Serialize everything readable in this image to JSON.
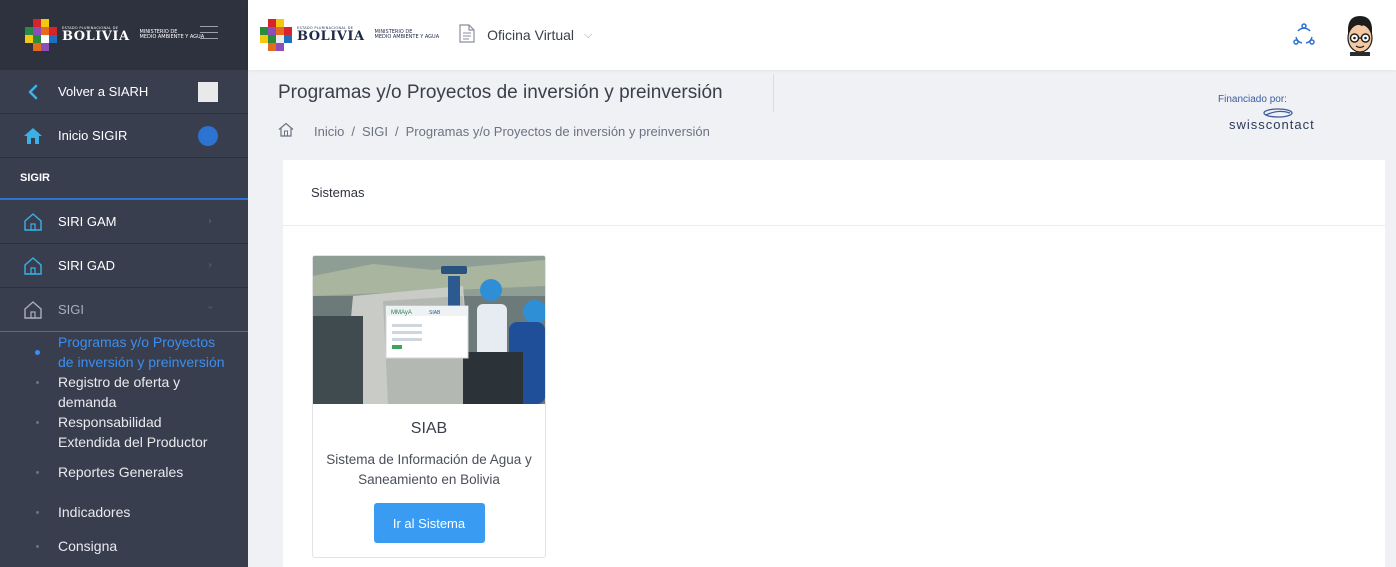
{
  "sidebar": {
    "brand": {
      "small": "ESTADO PLURINACIONAL DE",
      "big": "BOLIVIA",
      "ministry": "MINISTERIO DE\nMEDIO AMBIENTE Y AGUA"
    },
    "back_label": "Volver a SIARH",
    "home_label": "Inicio SIGIR",
    "section_label": "SIGIR",
    "items": [
      {
        "label": "SIRI GAM"
      },
      {
        "label": "SIRI GAD"
      },
      {
        "label": "SIGI"
      }
    ],
    "submenu": [
      {
        "label": "Programas y/o Proyectos de inversión y preinversión",
        "active": true
      },
      {
        "label": "Registro de oferta y demanda"
      },
      {
        "label": "Responsabilidad Extendida del Productor"
      },
      {
        "label": "Reportes Generales"
      },
      {
        "label": "Indicadores"
      },
      {
        "label": "Consigna"
      }
    ]
  },
  "topbar": {
    "brand": {
      "small": "ESTADO PLURINACIONAL DE",
      "big": "BOLIVIA",
      "ministry": "MINISTERIO DE\nMEDIO AMBIENTE Y AGUA"
    },
    "menu_label": "Oficina Virtual"
  },
  "header": {
    "title": "Programas y/o Proyectos de inversión y preinversión",
    "breadcrumb": [
      "Inicio",
      "SIGI",
      "Programas y/o Proyectos de inversión y preinversión"
    ],
    "financed_label": "Financiado por:",
    "financed_brand_a": "swiss",
    "financed_brand_b": "contact"
  },
  "panel": {
    "heading": "Sistemas",
    "card": {
      "title": "SIAB",
      "description": "Sistema de Información de Agua y Saneamiento en Bolivia",
      "button_label": "Ir al Sistema",
      "image_logo": "MMAyA",
      "image_text": "SIAB"
    }
  },
  "colors": {
    "sidebar_bg": "#393e4f",
    "accent": "#2c73d2",
    "active_link": "#3a8ff0",
    "button": "#3a9bf2"
  },
  "icons": [
    "chevron-left-icon",
    "home-icon",
    "building-icon",
    "chevron-right-icon",
    "chevron-down-icon",
    "document-icon",
    "share-icon",
    "avatar-icon"
  ]
}
